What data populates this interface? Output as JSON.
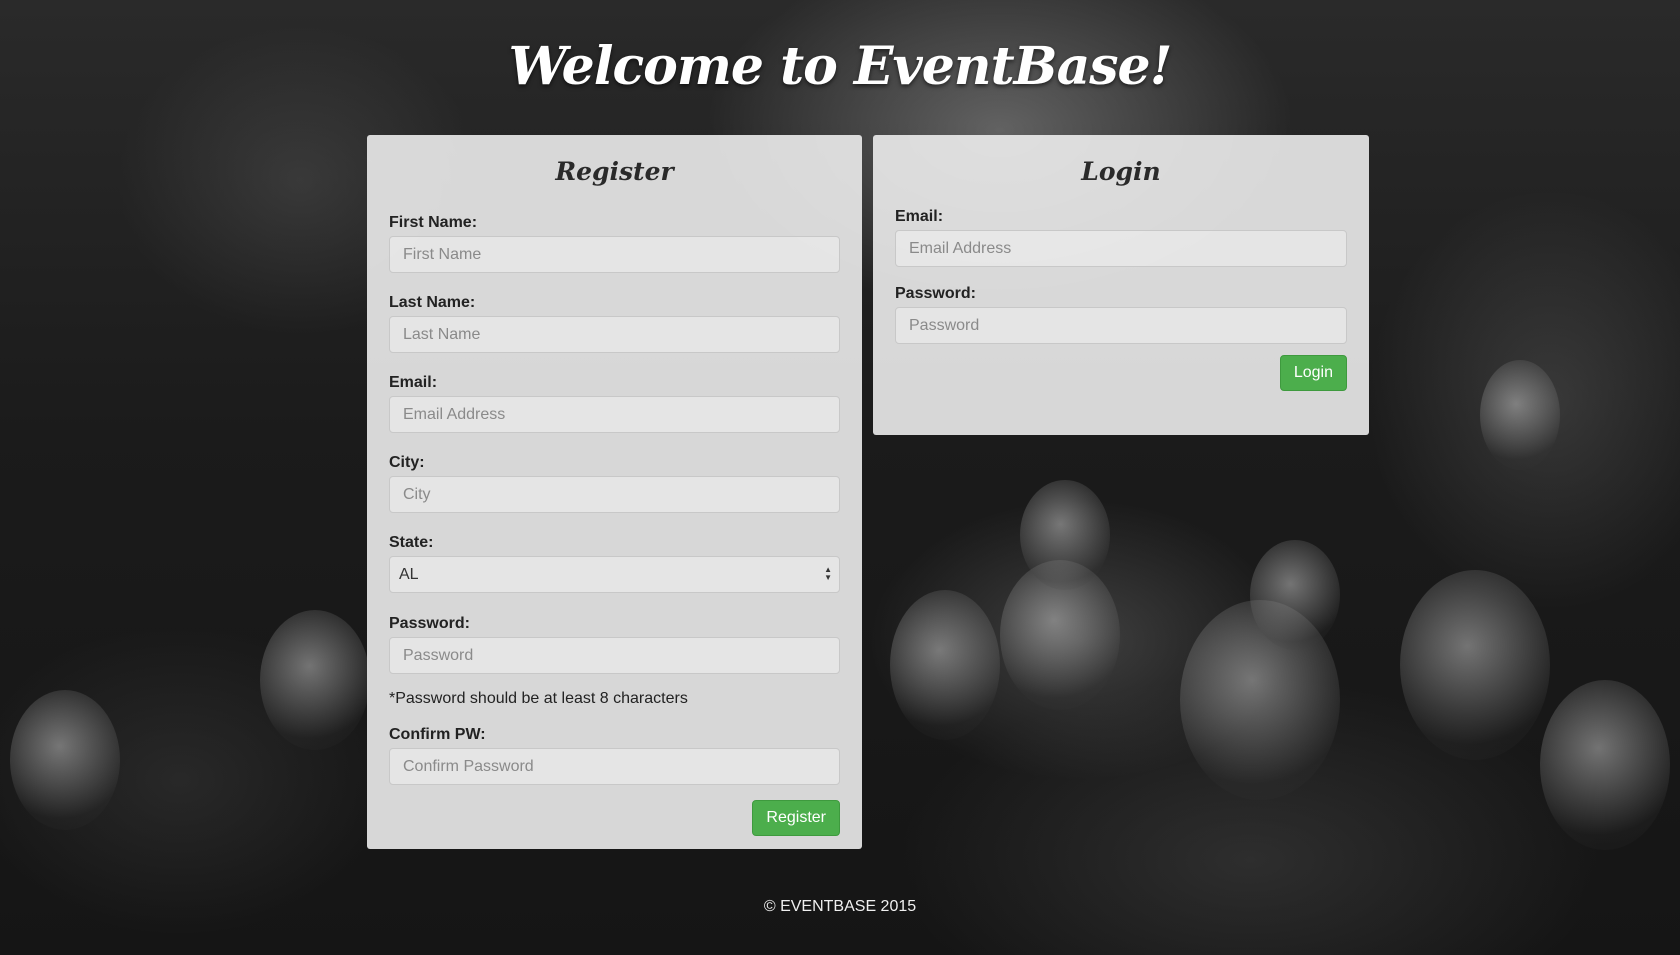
{
  "page": {
    "title": "Welcome to EventBase!"
  },
  "register": {
    "title": "Register",
    "first_name": {
      "label": "First Name:",
      "placeholder": "First Name"
    },
    "last_name": {
      "label": "Last Name:",
      "placeholder": "Last Name"
    },
    "email": {
      "label": "Email:",
      "placeholder": "Email Address"
    },
    "city": {
      "label": "City:",
      "placeholder": "City"
    },
    "state": {
      "label": "State:",
      "selected": "AL"
    },
    "password": {
      "label": "Password:",
      "placeholder": "Password"
    },
    "password_hint": "*Password should be at least 8 characters",
    "confirm": {
      "label": "Confirm PW:",
      "placeholder": "Confirm Password"
    },
    "submit_label": "Register"
  },
  "login": {
    "title": "Login",
    "email": {
      "label": "Email:",
      "placeholder": "Email Address"
    },
    "password": {
      "label": "Password:",
      "placeholder": "Password"
    },
    "submit_label": "Login"
  },
  "footer": {
    "text": "© EVENTBASE 2015"
  },
  "colors": {
    "button_green": "#4cae4c",
    "panel_bg": "#ececec"
  }
}
